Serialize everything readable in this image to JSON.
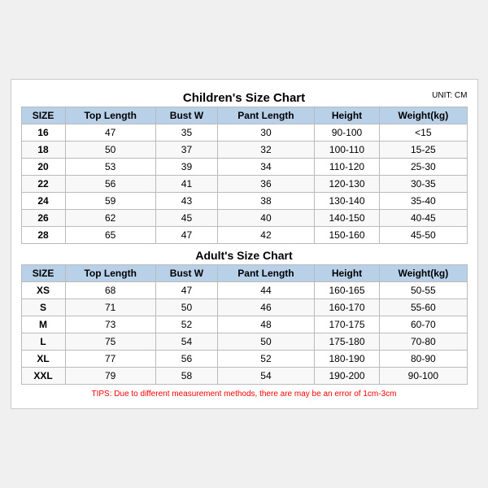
{
  "mainTitle": "Children's Size Chart",
  "unitLabel": "UNIT: CM",
  "childrenHeaders": [
    "SIZE",
    "Top Length",
    "Bust W",
    "Pant Length",
    "Height",
    "Weight(kg)"
  ],
  "childrenRows": [
    [
      "16",
      "47",
      "35",
      "30",
      "90-100",
      "<15"
    ],
    [
      "18",
      "50",
      "37",
      "32",
      "100-110",
      "15-25"
    ],
    [
      "20",
      "53",
      "39",
      "34",
      "110-120",
      "25-30"
    ],
    [
      "22",
      "56",
      "41",
      "36",
      "120-130",
      "30-35"
    ],
    [
      "24",
      "59",
      "43",
      "38",
      "130-140",
      "35-40"
    ],
    [
      "26",
      "62",
      "45",
      "40",
      "140-150",
      "40-45"
    ],
    [
      "28",
      "65",
      "47",
      "42",
      "150-160",
      "45-50"
    ]
  ],
  "adultTitle": "Adult's Size Chart",
  "adultHeaders": [
    "SIZE",
    "Top Length",
    "Bust W",
    "Pant Length",
    "Height",
    "Weight(kg)"
  ],
  "adultRows": [
    [
      "XS",
      "68",
      "47",
      "44",
      "160-165",
      "50-55"
    ],
    [
      "S",
      "71",
      "50",
      "46",
      "160-170",
      "55-60"
    ],
    [
      "M",
      "73",
      "52",
      "48",
      "170-175",
      "60-70"
    ],
    [
      "L",
      "75",
      "54",
      "50",
      "175-180",
      "70-80"
    ],
    [
      "XL",
      "77",
      "56",
      "52",
      "180-190",
      "80-90"
    ],
    [
      "XXL",
      "79",
      "58",
      "54",
      "190-200",
      "90-100"
    ]
  ],
  "tips": "TIPS: Due to different measurement methods, there are may be an error of 1cm-3cm"
}
